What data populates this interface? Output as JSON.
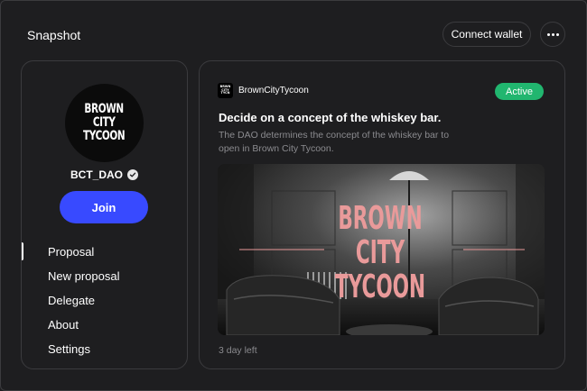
{
  "header": {
    "app_title": "Snapshot",
    "connect_label": "Connect wallet",
    "more_icon": "ellipsis-icon"
  },
  "space": {
    "logo_lines": [
      "BROWN",
      "CITY",
      "TYCOON"
    ],
    "name": "BCT_DAO",
    "verified_icon": "verified-badge-icon",
    "join_label": "Join"
  },
  "nav": {
    "items": [
      {
        "label": "Proposal",
        "active": true
      },
      {
        "label": "New proposal",
        "active": false
      },
      {
        "label": "Delegate",
        "active": false
      },
      {
        "label": "About",
        "active": false
      },
      {
        "label": "Settings",
        "active": false
      }
    ]
  },
  "proposal": {
    "author": "BrownCityTycoon",
    "status": "Active",
    "title": "Decide on a concept of the whiskey bar.",
    "description": "The DAO determines the concept of the whiskey bar to open in Brown City Tycoon.",
    "cover_text": [
      "BROWN",
      "CITY",
      "TYCOON"
    ],
    "time_left": "3 day left"
  },
  "colors": {
    "background": "#1e1e20",
    "border": "#3b3b3e",
    "join_button": "#384aff",
    "active_badge": "#21b66f",
    "muted_text": "#8b8b8f",
    "cover_title": "#e99a9a"
  }
}
